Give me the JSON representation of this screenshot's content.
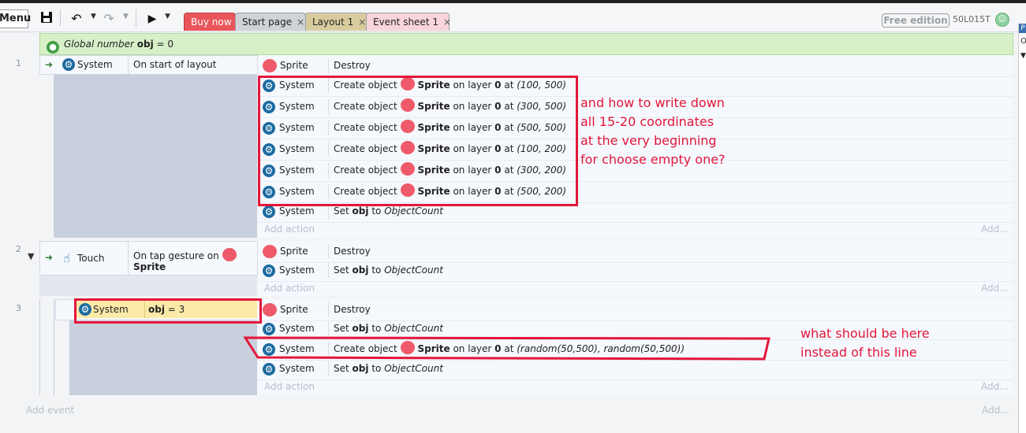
{
  "toolbar": {
    "menu_label": "Menu",
    "tabs": [
      {
        "label": "Buy now",
        "closable": false,
        "color": "#e8565b"
      },
      {
        "label": "Start page",
        "closable": true,
        "color": "#cfd2d6"
      },
      {
        "label": "Layout 1",
        "closable": true,
        "color": "#d8cc9f"
      },
      {
        "label": "Event sheet 1",
        "closable": true,
        "color": "#f7d5da"
      }
    ],
    "close_glyph": "×",
    "free_edition_label": "Free edition",
    "user_id": "50L015T"
  },
  "right_panel": {
    "letter_p": "P",
    "letter_o": "O",
    "caret": "▼"
  },
  "global_var": {
    "prefix": "Global number",
    "name": "obj",
    "rest": "= 0"
  },
  "events": [
    {
      "number": "1",
      "condition_object": "System",
      "condition_text": "On start of layout",
      "actions": [
        {
          "object": "Sprite",
          "text": "Destroy"
        },
        {
          "object": "System",
          "text": "Create object",
          "sprite": "Sprite",
          "layer_text": "on layer",
          "layer": "0",
          "at": "at",
          "coords": "(100, 500)"
        },
        {
          "object": "System",
          "text": "Create object",
          "sprite": "Sprite",
          "layer_text": "on layer",
          "layer": "0",
          "at": "at",
          "coords": "(300, 500)"
        },
        {
          "object": "System",
          "text": "Create object",
          "sprite": "Sprite",
          "layer_text": "on layer",
          "layer": "0",
          "at": "at",
          "coords": "(500, 500)"
        },
        {
          "object": "System",
          "text": "Create object",
          "sprite": "Sprite",
          "layer_text": "on layer",
          "layer": "0",
          "at": "at",
          "coords": "(100, 200)"
        },
        {
          "object": "System",
          "text": "Create object",
          "sprite": "Sprite",
          "layer_text": "on layer",
          "layer": "0",
          "at": "at",
          "coords": "(300, 200)"
        },
        {
          "object": "System",
          "text": "Create object",
          "sprite": "Sprite",
          "layer_text": "on layer",
          "layer": "0",
          "at": "at",
          "coords": "(500, 200)"
        },
        {
          "object": "System",
          "text_a": "Set",
          "var": "obj",
          "text_b": "to",
          "value": "ObjectCount"
        }
      ],
      "add_action": "Add action",
      "add_right": "Add..."
    },
    {
      "number": "2",
      "condition_object": "Touch",
      "condition_text": "On tap gesture on",
      "condition_sprite": "Sprite",
      "actions": [
        {
          "object": "Sprite",
          "text": "Destroy"
        },
        {
          "object": "System",
          "text_a": "Set",
          "var": "obj",
          "text_b": "to",
          "value": "ObjectCount"
        }
      ],
      "add_action": "Add action",
      "add_right": "Add..."
    },
    {
      "number": "3",
      "condition_object": "System",
      "condition_var": "obj",
      "condition_rest": "= 3",
      "actions": [
        {
          "object": "Sprite",
          "text": "Destroy"
        },
        {
          "object": "System",
          "text_a": "Set",
          "var": "obj",
          "text_b": "to",
          "value": "ObjectCount"
        },
        {
          "object": "System",
          "text": "Create object",
          "sprite": "Sprite",
          "layer_text": "on layer",
          "layer": "0",
          "at": "at",
          "coords": "(random(50,500), random(50,500))"
        },
        {
          "object": "System",
          "text_a": "Set",
          "var": "obj",
          "text_b": "to",
          "value": "ObjectCount"
        }
      ],
      "add_action": "Add action",
      "add_right": "Add..."
    }
  ],
  "add_event": "Add event",
  "add_event_right": "Add...",
  "annotations": {
    "note1": [
      "and how to write down",
      "all 15-20 coordinates",
      "at the very beginning",
      "for choose empty one?"
    ],
    "note2": [
      "what should be here",
      "instead of this line"
    ],
    "color": "#e3163a"
  }
}
